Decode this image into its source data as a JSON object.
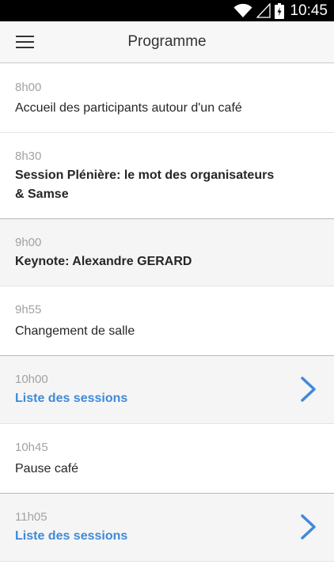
{
  "status_bar": {
    "time": "10:45",
    "icons": [
      "wifi-icon",
      "signal-icon",
      "battery-icon"
    ]
  },
  "header": {
    "title": "Programme",
    "menu_icon": "hamburger-menu-icon"
  },
  "colors": {
    "link": "#3f8ad8",
    "time": "#a2a2a2",
    "highlight_bg": "#f5f5f5"
  },
  "schedule": [
    {
      "time": "8h00",
      "title": "Accueil des participants autour d'un café"
    },
    {
      "time": "8h30",
      "title": "Session Plénière: le mot des organisateurs & Samse"
    },
    {
      "time": "9h00",
      "title": "Keynote: Alexandre GERARD"
    },
    {
      "time": "9h55",
      "title": "Changement de salle"
    },
    {
      "time": "10h00",
      "title": "Liste des sessions",
      "icon": "chevron-right-icon"
    },
    {
      "time": "10h45",
      "title": "Pause café"
    },
    {
      "time": "11h05",
      "title": "Liste des sessions",
      "icon": "chevron-right-icon"
    }
  ]
}
